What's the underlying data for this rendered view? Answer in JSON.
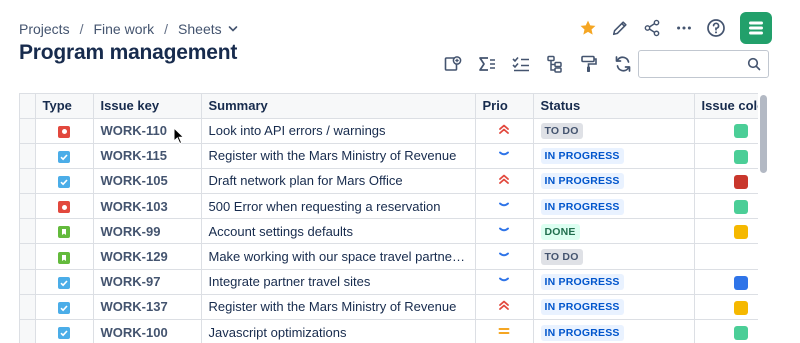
{
  "breadcrumb": {
    "items": [
      "Projects",
      "Fine work",
      "Sheets"
    ],
    "separator": "/"
  },
  "page": {
    "title": "Program management"
  },
  "top_actions": {
    "icons": [
      "star-icon",
      "pencil-icon",
      "share-icon",
      "more-icon",
      "help-icon",
      "app-logo-icon"
    ],
    "star_color": "#f5a623",
    "logo_color": "#22a06b"
  },
  "toolbar": {
    "icons": [
      "add-card-icon",
      "sum-icon",
      "checklist-icon",
      "hierarchy-icon",
      "format-paint-icon",
      "refresh-icon"
    ]
  },
  "search": {
    "placeholder": ""
  },
  "table": {
    "columns": [
      "Type",
      "Issue key",
      "Summary",
      "Prio",
      "Status",
      "Issue colo"
    ],
    "rows": [
      {
        "type": "bug",
        "key": "WORK-110",
        "summary": "Look into API errors / warnings",
        "prio": "highest",
        "status": "TO DO",
        "color": "#4bce97"
      },
      {
        "type": "task",
        "key": "WORK-115",
        "summary": "Register with the Mars Ministry of Revenue",
        "prio": "low",
        "status": "IN PROGRESS",
        "color": "#4bce97"
      },
      {
        "type": "task",
        "key": "WORK-105",
        "summary": "Draft network plan for Mars Office",
        "prio": "highest",
        "status": "IN PROGRESS",
        "color": "#c9372c"
      },
      {
        "type": "bug",
        "key": "WORK-103",
        "summary": "500 Error when requesting a reservation",
        "prio": "low",
        "status": "IN PROGRESS",
        "color": "#4bce97"
      },
      {
        "type": "story",
        "key": "WORK-99",
        "summary": "Account settings defaults",
        "prio": "low",
        "status": "DONE",
        "color": "#f5b800"
      },
      {
        "type": "story",
        "key": "WORK-129",
        "summary": "Make working with our space travel partners ...",
        "prio": "low",
        "status": "TO DO",
        "color": ""
      },
      {
        "type": "task",
        "key": "WORK-97",
        "summary": "Integrate partner travel sites",
        "prio": "low",
        "status": "IN PROGRESS",
        "color": "#2f74e8"
      },
      {
        "type": "task",
        "key": "WORK-137",
        "summary": "Register with the Mars Ministry of Revenue",
        "prio": "highest",
        "status": "IN PROGRESS",
        "color": "#f5b800"
      },
      {
        "type": "task",
        "key": "WORK-100",
        "summary": "Javascript optimizations",
        "prio": "medium",
        "status": "IN PROGRESS",
        "color": "#4bce97"
      }
    ]
  },
  "colors": {
    "prio_highest": "#e2483d",
    "prio_low": "#2f74e8",
    "prio_medium": "#f5a623"
  }
}
